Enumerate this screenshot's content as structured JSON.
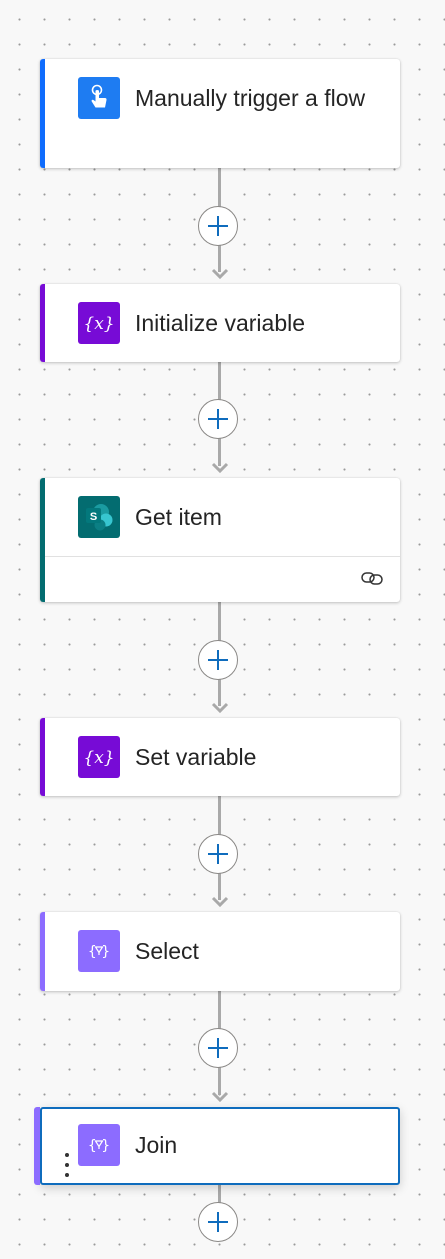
{
  "flow": {
    "steps": [
      {
        "id": "manual-trigger",
        "title": "Manually trigger a flow",
        "icon": "touch-hand-icon",
        "accent_color": "#0f6cfd",
        "icon_bg": "#1e7cf2"
      },
      {
        "id": "initialize-variable",
        "title": "Initialize variable",
        "icon": "variable-icon",
        "accent_color": "#770bd6",
        "icon_bg": "#770bd6"
      },
      {
        "id": "get-item",
        "title": "Get item",
        "icon": "sharepoint-icon",
        "accent_color": "#036c70",
        "icon_bg": "#036c70",
        "footer_icon": "connection-link-icon"
      },
      {
        "id": "set-variable",
        "title": "Set variable",
        "icon": "variable-icon",
        "accent_color": "#770bd6",
        "icon_bg": "#770bd6"
      },
      {
        "id": "select",
        "title": "Select",
        "icon": "data-operation-icon",
        "accent_color": "#8c6cff",
        "icon_bg": "#8c6cff"
      },
      {
        "id": "join",
        "title": "Join",
        "icon": "data-operation-icon",
        "accent_color": "#8c6cff",
        "icon_bg": "#8c6cff",
        "selected": true
      }
    ],
    "add_action_icon": "plus-icon",
    "colors": {
      "connector": "#a9a9a9",
      "add_plus": "#0f6cbd",
      "selection_border": "#0f6cbd"
    }
  }
}
